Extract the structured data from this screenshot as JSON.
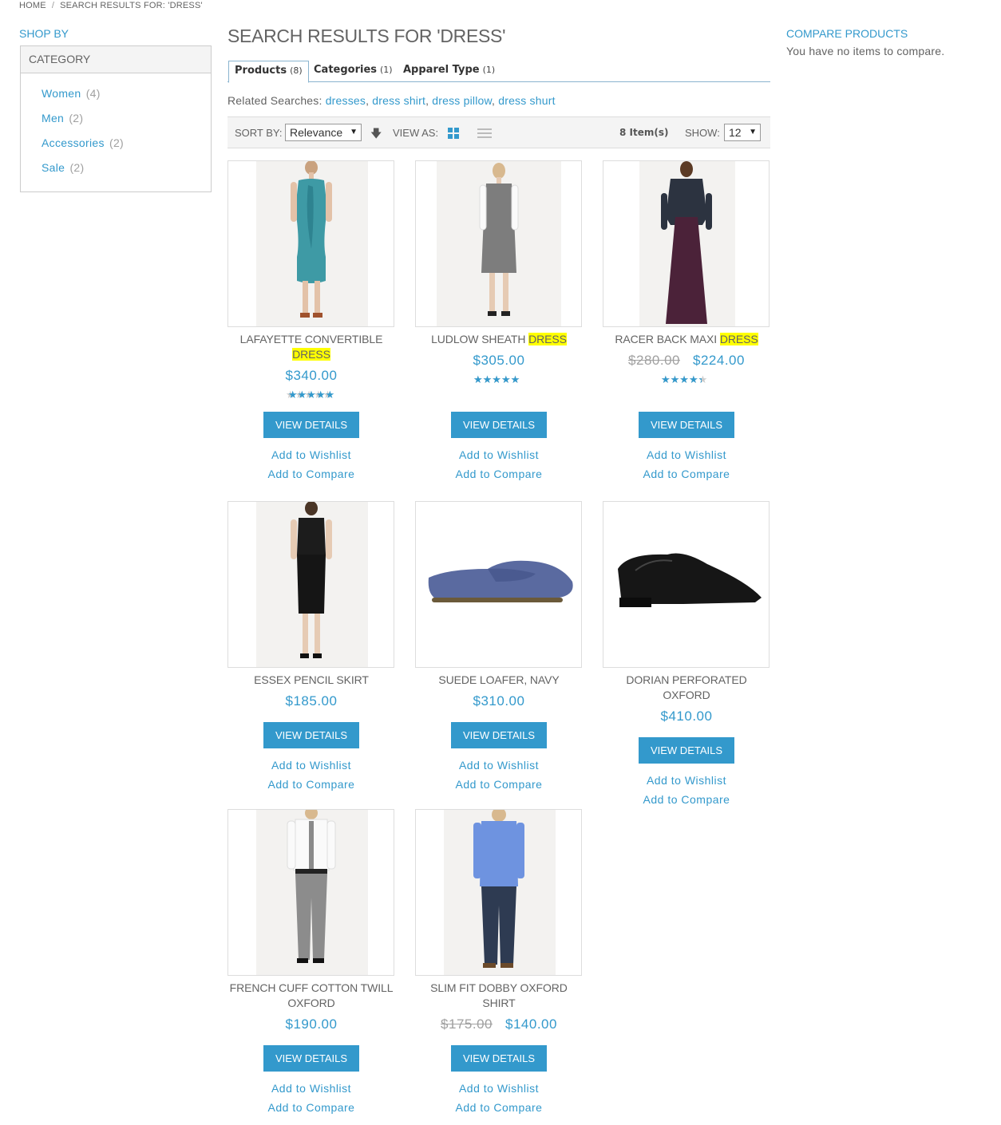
{
  "breadcrumb": {
    "home": "HOME",
    "separator": "/",
    "current": "SEARCH RESULTS FOR: 'DRESS'"
  },
  "sidebar": {
    "title": "SHOP BY",
    "category_header": "CATEGORY",
    "categories": [
      {
        "label": "Women",
        "count": "(4)"
      },
      {
        "label": "Men",
        "count": "(2)"
      },
      {
        "label": "Accessories",
        "count": "(2)"
      },
      {
        "label": "Sale",
        "count": "(2)"
      }
    ]
  },
  "compare": {
    "title": "COMPARE PRODUCTS",
    "empty_text": "You have no items to compare."
  },
  "main": {
    "title": "SEARCH RESULTS FOR 'DRESS'",
    "tabs": [
      {
        "label": "Products",
        "count": "(8)"
      },
      {
        "label": "Categories",
        "count": "(1)"
      },
      {
        "label": "Apparel Type",
        "count": "(1)"
      }
    ],
    "related": {
      "label": "Related Searches:",
      "terms": [
        "dresses",
        "dress shirt",
        "dress pillow",
        "dress shurt"
      ]
    }
  },
  "toolbar": {
    "sort_label": "SORT BY:",
    "sort_value": "Relevance",
    "sort_direction_icon": "arrow-down-icon",
    "view_label": "VIEW AS:",
    "count_text": "8 Item(s)",
    "show_label": "SHOW:",
    "show_value": "12"
  },
  "colors": {
    "accent": "#3399cc",
    "highlight": "#ffff00",
    "text": "#636363"
  },
  "products": [
    {
      "name_pre": "LAFAYETTE CONVERTIBLE",
      "name_hl": "DRESS",
      "old_price": "",
      "price": "$340.00",
      "rating": 1.0,
      "button": "VIEW DETAILS",
      "wishlist": "Add to Wishlist",
      "compare": "Add to Compare",
      "image": "teal-dress"
    },
    {
      "name_pre": "LUDLOW SHEATH",
      "name_hl": "DRESS",
      "old_price": "",
      "price": "$305.00",
      "rating": 0.9,
      "button": "VIEW DETAILS",
      "wishlist": "Add to Wishlist",
      "compare": "Add to Compare",
      "image": "gray-sheath-dress"
    },
    {
      "name_pre": "RACER BACK MAXI",
      "name_hl": "DRESS",
      "old_price": "$280.00",
      "price": "$224.00",
      "rating": 0.8,
      "button": "VIEW DETAILS",
      "wishlist": "Add to Wishlist",
      "compare": "Add to Compare",
      "image": "plum-maxi-dress"
    },
    {
      "name_pre": "ESSEX PENCIL SKIRT",
      "name_hl": "",
      "old_price": "",
      "price": "$185.00",
      "rating": null,
      "button": "VIEW DETAILS",
      "wishlist": "Add to Wishlist",
      "compare": "Add to Compare",
      "image": "black-pencil-skirt"
    },
    {
      "name_pre": "SUEDE LOAFER, NAVY",
      "name_hl": "",
      "old_price": "",
      "price": "$310.00",
      "rating": null,
      "button": "VIEW DETAILS",
      "wishlist": "Add to Wishlist",
      "compare": "Add to Compare",
      "image": "navy-loafer"
    },
    {
      "name_pre": "DORIAN PERFORATED OXFORD",
      "name_hl": "",
      "old_price": "",
      "price": "$410.00",
      "rating": null,
      "button": "VIEW DETAILS",
      "wishlist": "Add to Wishlist",
      "compare": "Add to Compare",
      "image": "black-oxford-shoe"
    },
    {
      "name_pre": "FRENCH CUFF COTTON TWILL OXFORD",
      "name_hl": "",
      "old_price": "",
      "price": "$190.00",
      "rating": null,
      "button": "VIEW DETAILS",
      "wishlist": "Add to Wishlist",
      "compare": "Add to Compare",
      "image": "white-shirt-gray-pants"
    },
    {
      "name_pre": "SLIM FIT DOBBY OXFORD SHIRT",
      "name_hl": "",
      "old_price": "$175.00",
      "price": "$140.00",
      "rating": null,
      "button": "VIEW DETAILS",
      "wishlist": "Add to Wishlist",
      "compare": "Add to Compare",
      "image": "blue-shirt-jeans"
    }
  ]
}
